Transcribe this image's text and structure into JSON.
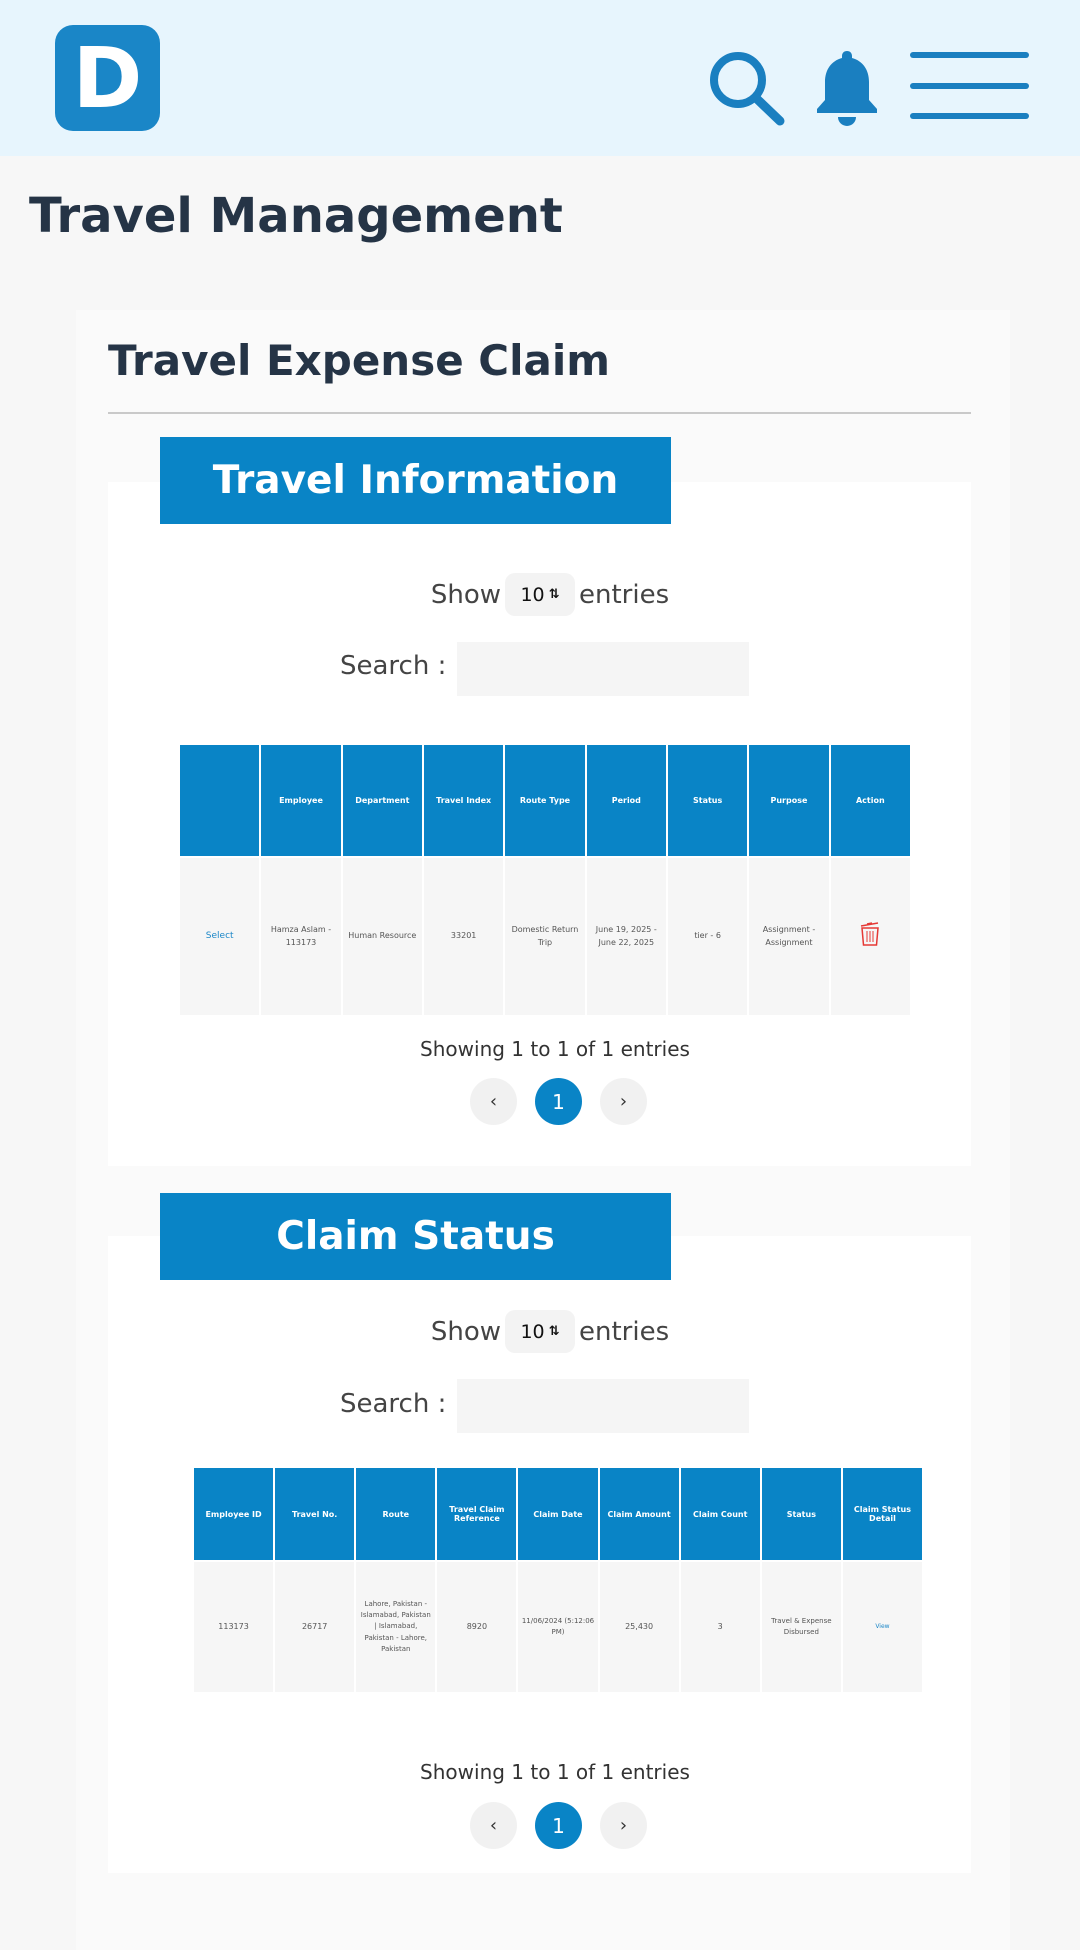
{
  "header": {
    "logo_letter": "D",
    "icons": [
      "search-icon",
      "bell-icon",
      "menu-icon"
    ]
  },
  "page_title": "Travel Management",
  "card_title": "Travel Expense Claim",
  "colors": {
    "accent": "#0984c6",
    "delete": "#e53935"
  },
  "travel_info": {
    "banner": "Travel Information",
    "show_label": "Show",
    "entries_value": "10",
    "entries_label": "entries",
    "search_label": "Search :",
    "search_value": "",
    "columns": [
      "",
      "Employee",
      "Department",
      "Travel Index",
      "Route Type",
      "Period",
      "Status",
      "Purpose",
      "Action"
    ],
    "rows": [
      {
        "select": "Select",
        "employee": "Hamza Aslam - 113173",
        "department": "Human Resource",
        "travel_index": "33201",
        "route_type": "Domestic Return Trip",
        "period": "June 19, 2025 - June 22, 2025",
        "status": "tier - 6",
        "purpose": "Assignment - Assignment",
        "action": "delete-icon"
      }
    ],
    "showing": "Showing 1 to 1 of 1 entries",
    "pagination": {
      "prev": "‹",
      "current": "1",
      "next": "›"
    }
  },
  "claim_status": {
    "banner": "Claim Status",
    "show_label": "Show",
    "entries_value": "10",
    "entries_label": "entries",
    "search_label": "Search :",
    "search_value": "",
    "columns": [
      "Employee ID",
      "Travel No.",
      "Route",
      "Travel Claim Reference",
      "Claim Date",
      "Claim Amount",
      "Claim Count",
      "Status",
      "Claim Status Detail"
    ],
    "rows": [
      {
        "employee_id": "113173",
        "travel_no": "26717",
        "route": "Lahore, Pakistan - Islamabad, Pakistan | Islamabad, Pakistan - Lahore, Pakistan",
        "reference": "8920",
        "claim_date": "11/06/2024 (5:12:06 PM)",
        "amount": "25,430",
        "count": "3",
        "status": "Travel & Expense Disbursed",
        "detail": "View"
      }
    ],
    "showing": "Showing 1 to 1 of 1 entries",
    "pagination": {
      "prev": "‹",
      "current": "1",
      "next": "›"
    }
  }
}
